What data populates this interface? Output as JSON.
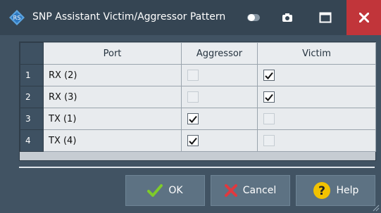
{
  "window": {
    "title": "SNP Assistant Victim/Aggressor Pattern"
  },
  "table": {
    "columns": [
      "Port",
      "Aggressor",
      "Victim"
    ],
    "rows": [
      {
        "index": "1",
        "port": "RX (2)",
        "aggressor": false,
        "victim": true
      },
      {
        "index": "2",
        "port": "RX (3)",
        "aggressor": false,
        "victim": true
      },
      {
        "index": "3",
        "port": "TX (1)",
        "aggressor": true,
        "victim": false
      },
      {
        "index": "4",
        "port": "TX (4)",
        "aggressor": true,
        "victim": false
      }
    ]
  },
  "buttons": {
    "ok": "OK",
    "cancel": "Cancel",
    "help": "Help"
  },
  "icons": {
    "app": "rohde-schwarz-logo-icon",
    "toggle": "toggle-icon",
    "camera": "camera-icon",
    "maximize": "maximize-icon",
    "close": "close-icon",
    "ok": "checkmark-icon",
    "cancel": "x-icon",
    "help": "question-icon"
  },
  "colors": {
    "titlebar": "#354553",
    "close": "#c1353a",
    "ok_check": "#7ecb2a",
    "cancel_x": "#e0393f",
    "help_circle": "#f2c200"
  }
}
